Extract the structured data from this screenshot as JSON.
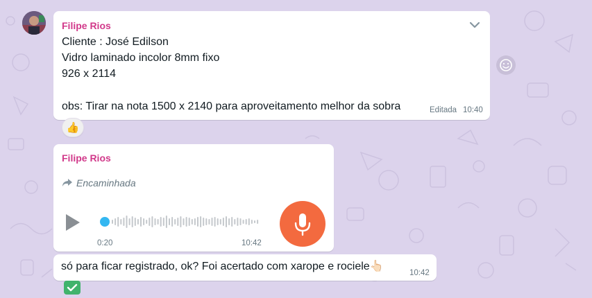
{
  "messages": [
    {
      "sender": "Filipe Rios",
      "lines": [
        "Cliente : José Edilson",
        "Vidro laminado incolor 8mm fixo",
        "926 x 2114",
        "obs: Tirar na nota 1500 x 2140 para aproveitamento melhor da sobra"
      ],
      "edited_label": "Editada",
      "time": "10:40",
      "reaction": "👍"
    },
    {
      "sender": "Filipe Rios",
      "forwarded_label": "Encaminhada",
      "voice_duration": "0:20",
      "time": "10:42",
      "progress": 0.0
    },
    {
      "text": "só para ficar registrado, ok? Foi acertado com xarope e rociele👆🏻",
      "time": "10:42",
      "reaction": "✅"
    }
  ],
  "colors": {
    "wallpaper": "#dcd3ec",
    "sender": "#d1398a",
    "mic_button": "#f36a3f",
    "progress_dot": "#34b7f1"
  },
  "icons": [
    "avatar",
    "chevron-down-icon",
    "emoji-icon",
    "forward-arrow-icon",
    "play-icon",
    "microphone-icon"
  ]
}
